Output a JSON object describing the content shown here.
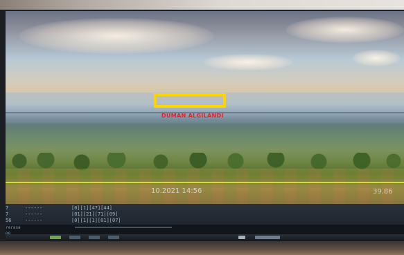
{
  "camera": {
    "detection_label": "DUMAN ALGILANDI",
    "timestamp": "10.2021 14:56",
    "right_value": "39.86"
  },
  "log": {
    "rows": [
      {
        "left": "7",
        "dashes": "------",
        "code": "[0][1][47][44]"
      },
      {
        "left": "7",
        "dashes": "------",
        "code": "[01][21][71][09]"
      },
      {
        "left": "56",
        "dashes": "------",
        "code": "[0][1][1][01][07]"
      }
    ],
    "status_1": "rerasa",
    "status_2": "08"
  },
  "icons": [
    "taskbar-icon-a",
    "taskbar-icon-b",
    "taskbar-icon-c",
    "taskbar-icon-d",
    "taskbar-icon-e",
    "taskbar-icon-f"
  ]
}
